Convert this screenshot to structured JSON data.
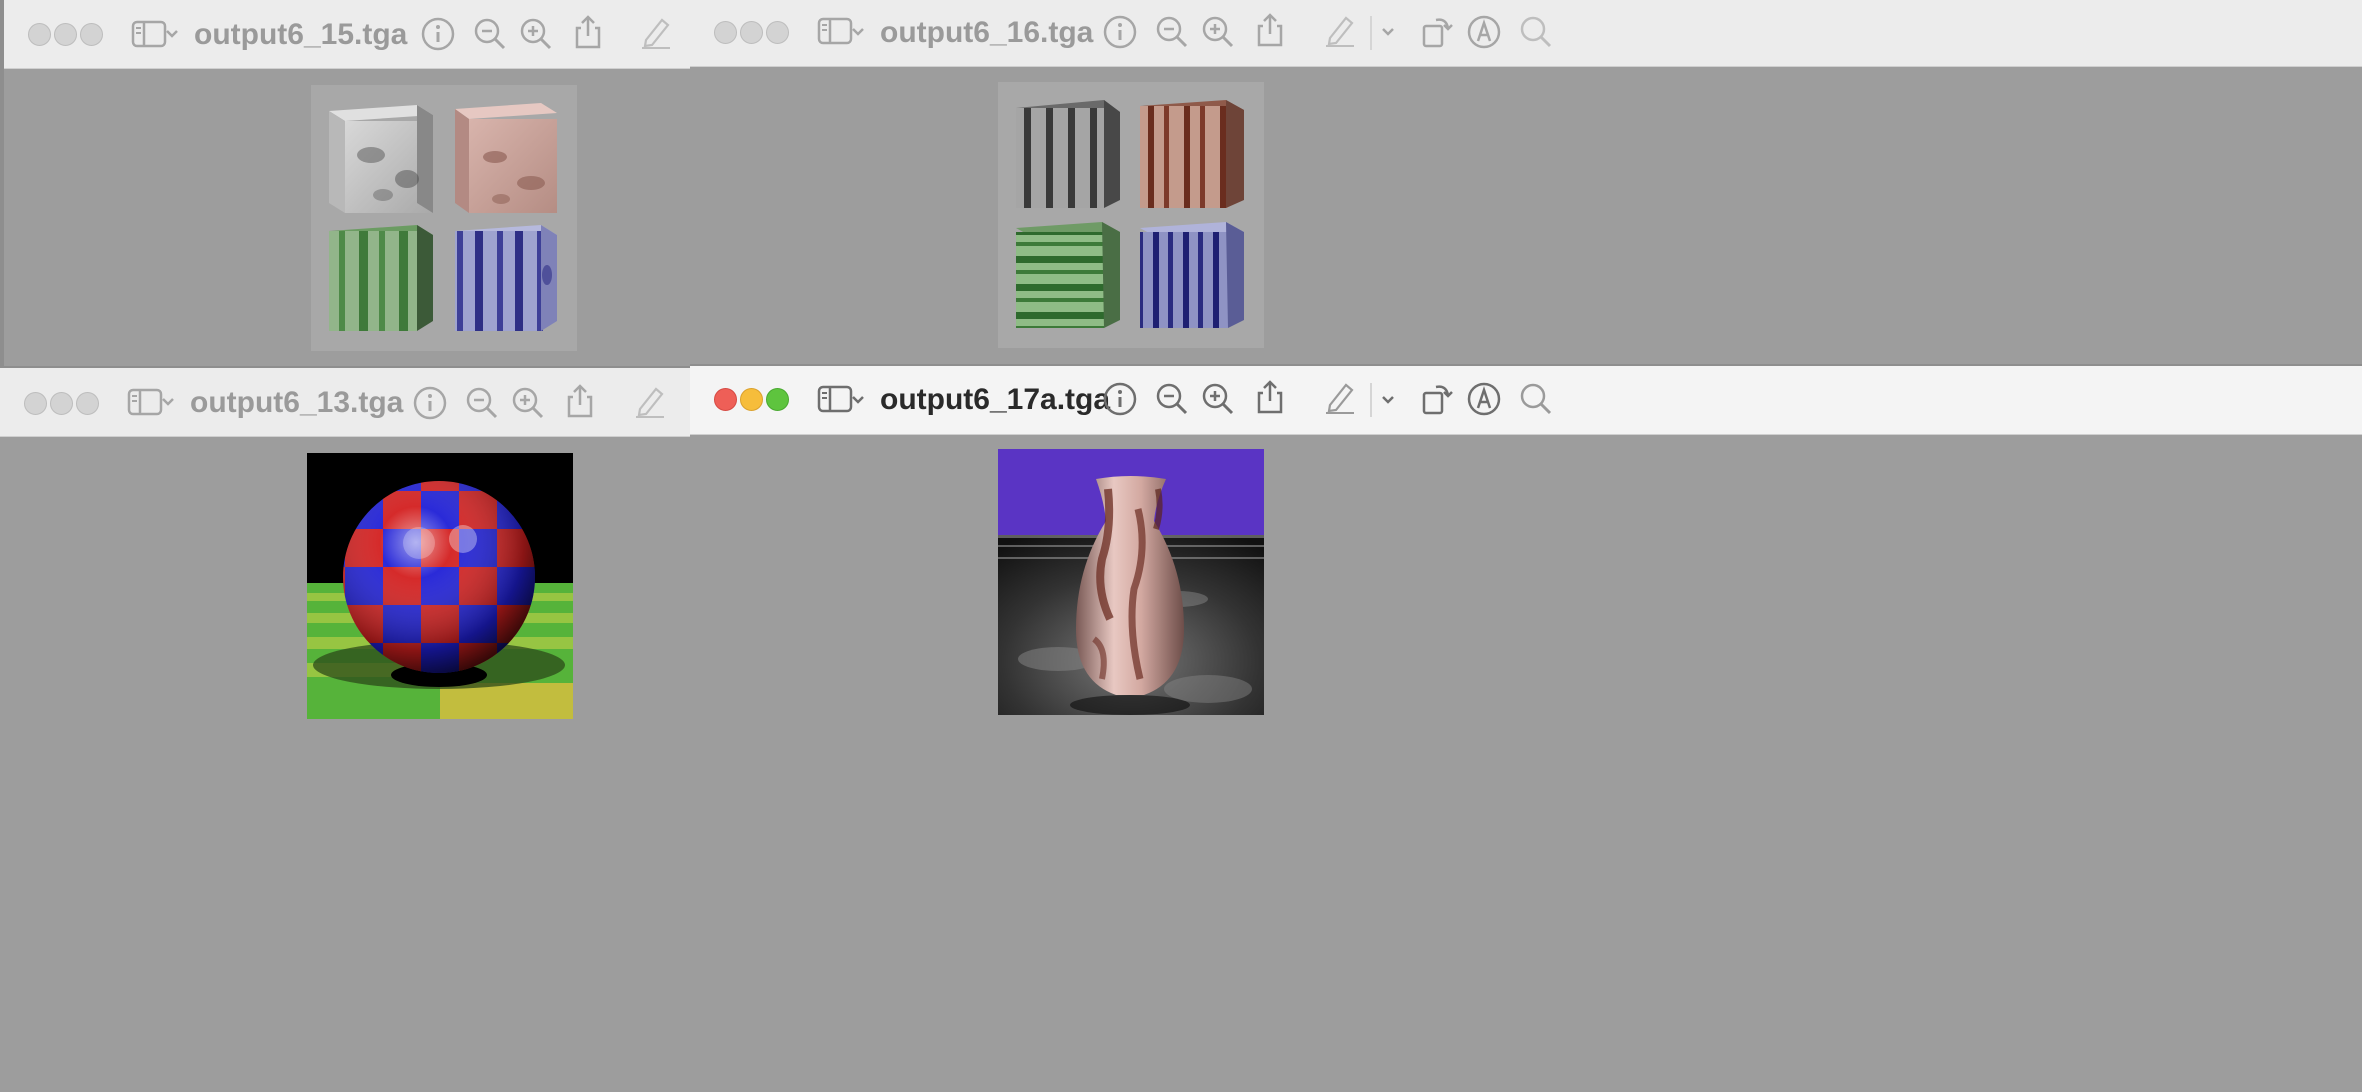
{
  "windows": [
    {
      "id": "w15",
      "title": "output6_15.tga",
      "state": "inactive"
    },
    {
      "id": "w16",
      "title": "output6_16.tga",
      "state": "inactive"
    },
    {
      "id": "w13",
      "title": "output6_13.tga",
      "state": "inactive"
    },
    {
      "id": "w17a",
      "title": "output6_17a.tga",
      "state": "active"
    }
  ],
  "toolbar_icons": [
    "sidebar-icon",
    "chevron-down-icon",
    "info-icon",
    "zoom-out-icon",
    "zoom-in-icon",
    "share-icon",
    "markup-pencil-icon",
    "rotate-icon",
    "annotate-icon",
    "search-icon"
  ],
  "colors": {
    "close": "#ee5f57",
    "minimize": "#f6bd3b",
    "zoom": "#5ec43e",
    "canvas": "#9d9d9d"
  }
}
